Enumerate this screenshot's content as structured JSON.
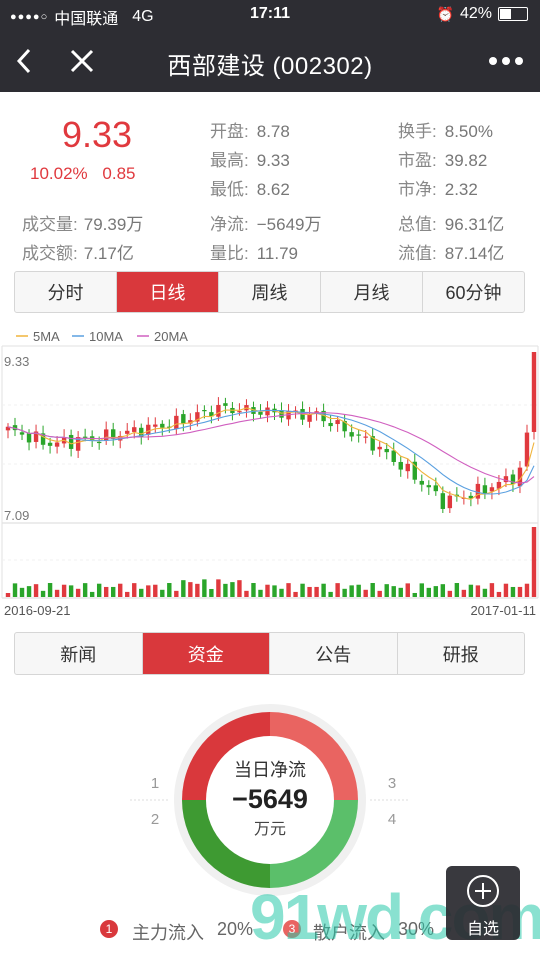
{
  "status": {
    "carrier": "中国联通",
    "network": "4G",
    "time": "17:11",
    "battery": "42%"
  },
  "nav": {
    "title": "西部建设 (002302)"
  },
  "quote": {
    "price": "9.33",
    "change_pct": "10.02%",
    "change": "0.85",
    "open_label": "开盘:",
    "open": "8.78",
    "high_label": "最高:",
    "high": "9.33",
    "low_label": "最低:",
    "low": "8.62",
    "turnover_label": "换手:",
    "turnover": "8.50%",
    "pe_label": "市盈:",
    "pe": "39.82",
    "pb_label": "市净:",
    "pb": "2.32",
    "volume_label": "成交量:",
    "volume": "79.39万",
    "amount_label": "成交额:",
    "amount": "7.17亿",
    "netflow_label": "净流:",
    "netflow": "−5649万",
    "volratio_label": "量比:",
    "volratio": "11.79",
    "mktcap_label": "总值:",
    "mktcap": "96.31亿",
    "float_label": "流值:",
    "float": "87.14亿"
  },
  "chart_tabs": [
    "分时",
    "日线",
    "周线",
    "月线",
    "60分钟"
  ],
  "chart_data": {
    "type": "candlestick",
    "legend": [
      "5MA",
      "10MA",
      "20MA"
    ],
    "legend_colors": [
      "#f0b43c",
      "#5aa0e0",
      "#d060c0"
    ],
    "ymax_label": "9.33",
    "ymin_label": "7.09",
    "ylim": [
      7.09,
      9.33
    ],
    "start_date": "2016-09-21",
    "end_date": "2017-01-11",
    "up_color": "#e0393e",
    "down_color": "#2aa52a"
  },
  "info_tabs": [
    "新闻",
    "资金",
    "公告",
    "研报"
  ],
  "donut": {
    "title": "当日净流",
    "value": "−5649",
    "unit": "万元",
    "quadrants": [
      "1",
      "2",
      "3",
      "4"
    ],
    "colors": [
      "#d9383c",
      "#e96461",
      "#3e9a32",
      "#5bbf6a"
    ]
  },
  "legend": {
    "main_label": "主力流入",
    "main_pct": "20%",
    "retail_label": "散户流入",
    "retail_pct": "30%"
  },
  "watch": {
    "label": "自选"
  },
  "watermark": "91wd.com"
}
